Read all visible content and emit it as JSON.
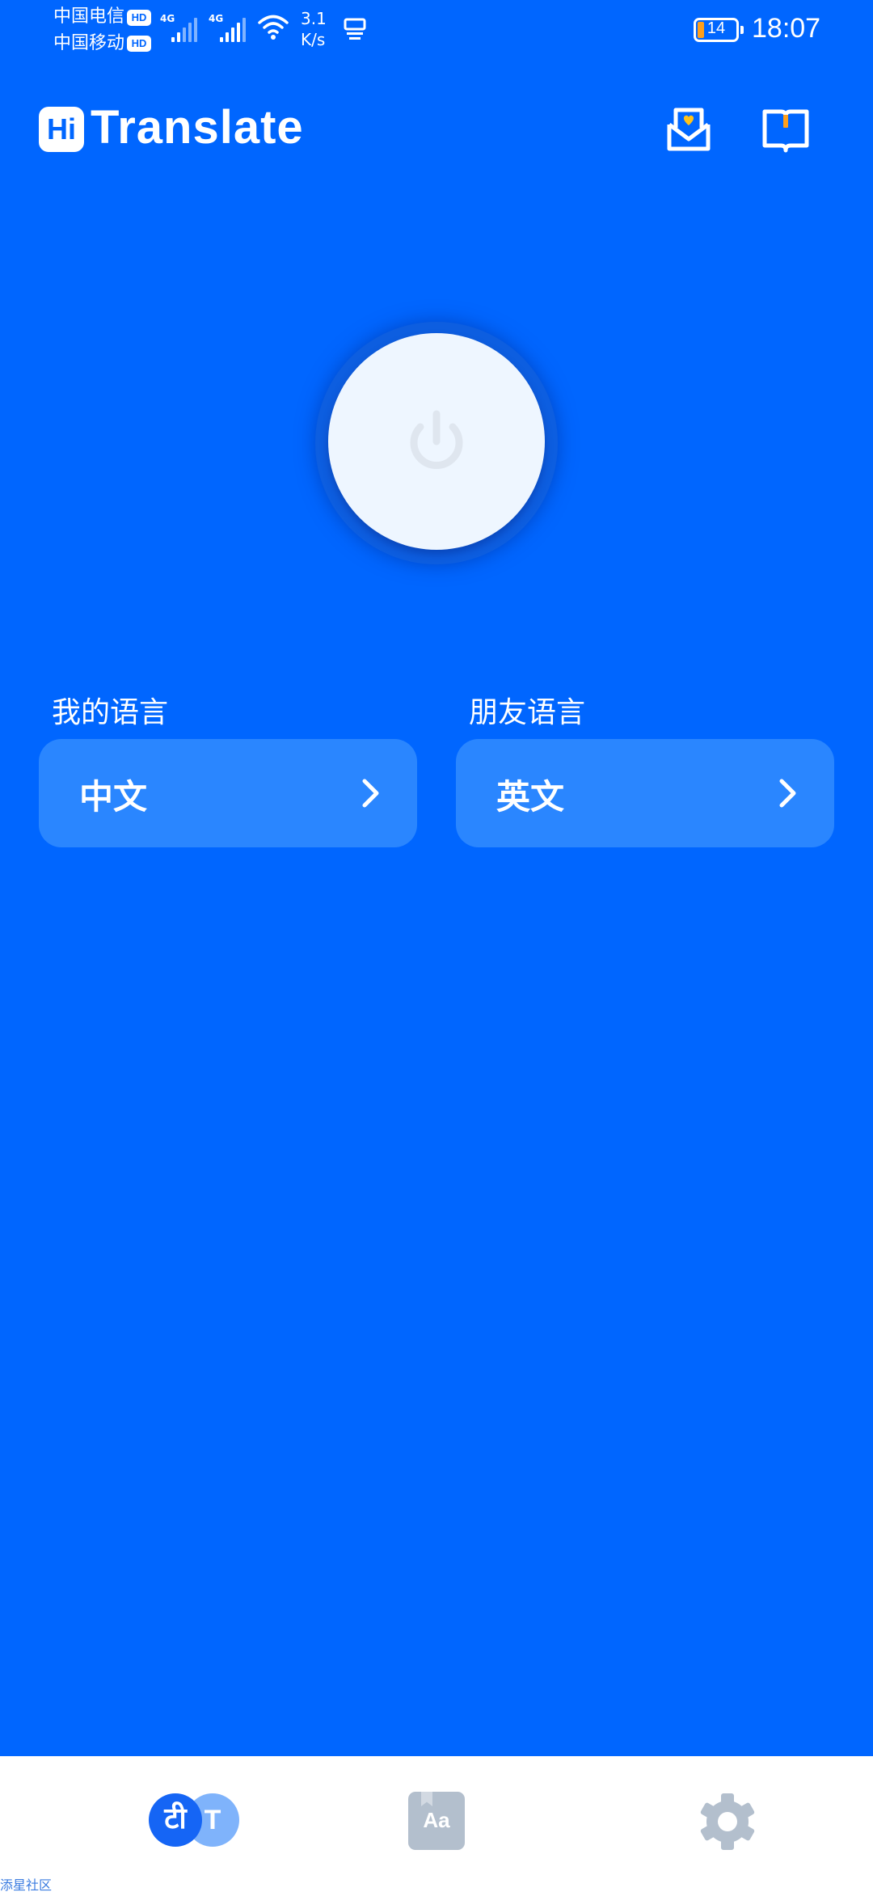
{
  "status_bar": {
    "carrier_1": "中国电信",
    "carrier_2": "中国移动",
    "hd_badge": "HD",
    "network_1": "4G",
    "network_2": "4G",
    "speed_value": "3.1",
    "speed_unit": "K/s",
    "battery": "14",
    "time": "18:07"
  },
  "header": {
    "logo_mark": "Hi",
    "title": "Translate",
    "mail_icon": "mail-heart-icon",
    "book_icon": "open-book-icon"
  },
  "power_button": {
    "icon": "power-icon"
  },
  "languages": {
    "mine_label": "我的语言",
    "mine_value": "中文",
    "friend_label": "朋友语言",
    "friend_value": "英文"
  },
  "bottom_nav": {
    "translate_glyph_a": "टी",
    "translate_glyph_b": "T",
    "dictionary_glyph": "Aa",
    "settings_icon": "gear-icon"
  },
  "watermark": "添星社区",
  "colors": {
    "background": "#0066ff",
    "card": "#2a86ff",
    "nav_active": "#1565f5",
    "nav_inactive": "#b3bfcd"
  }
}
